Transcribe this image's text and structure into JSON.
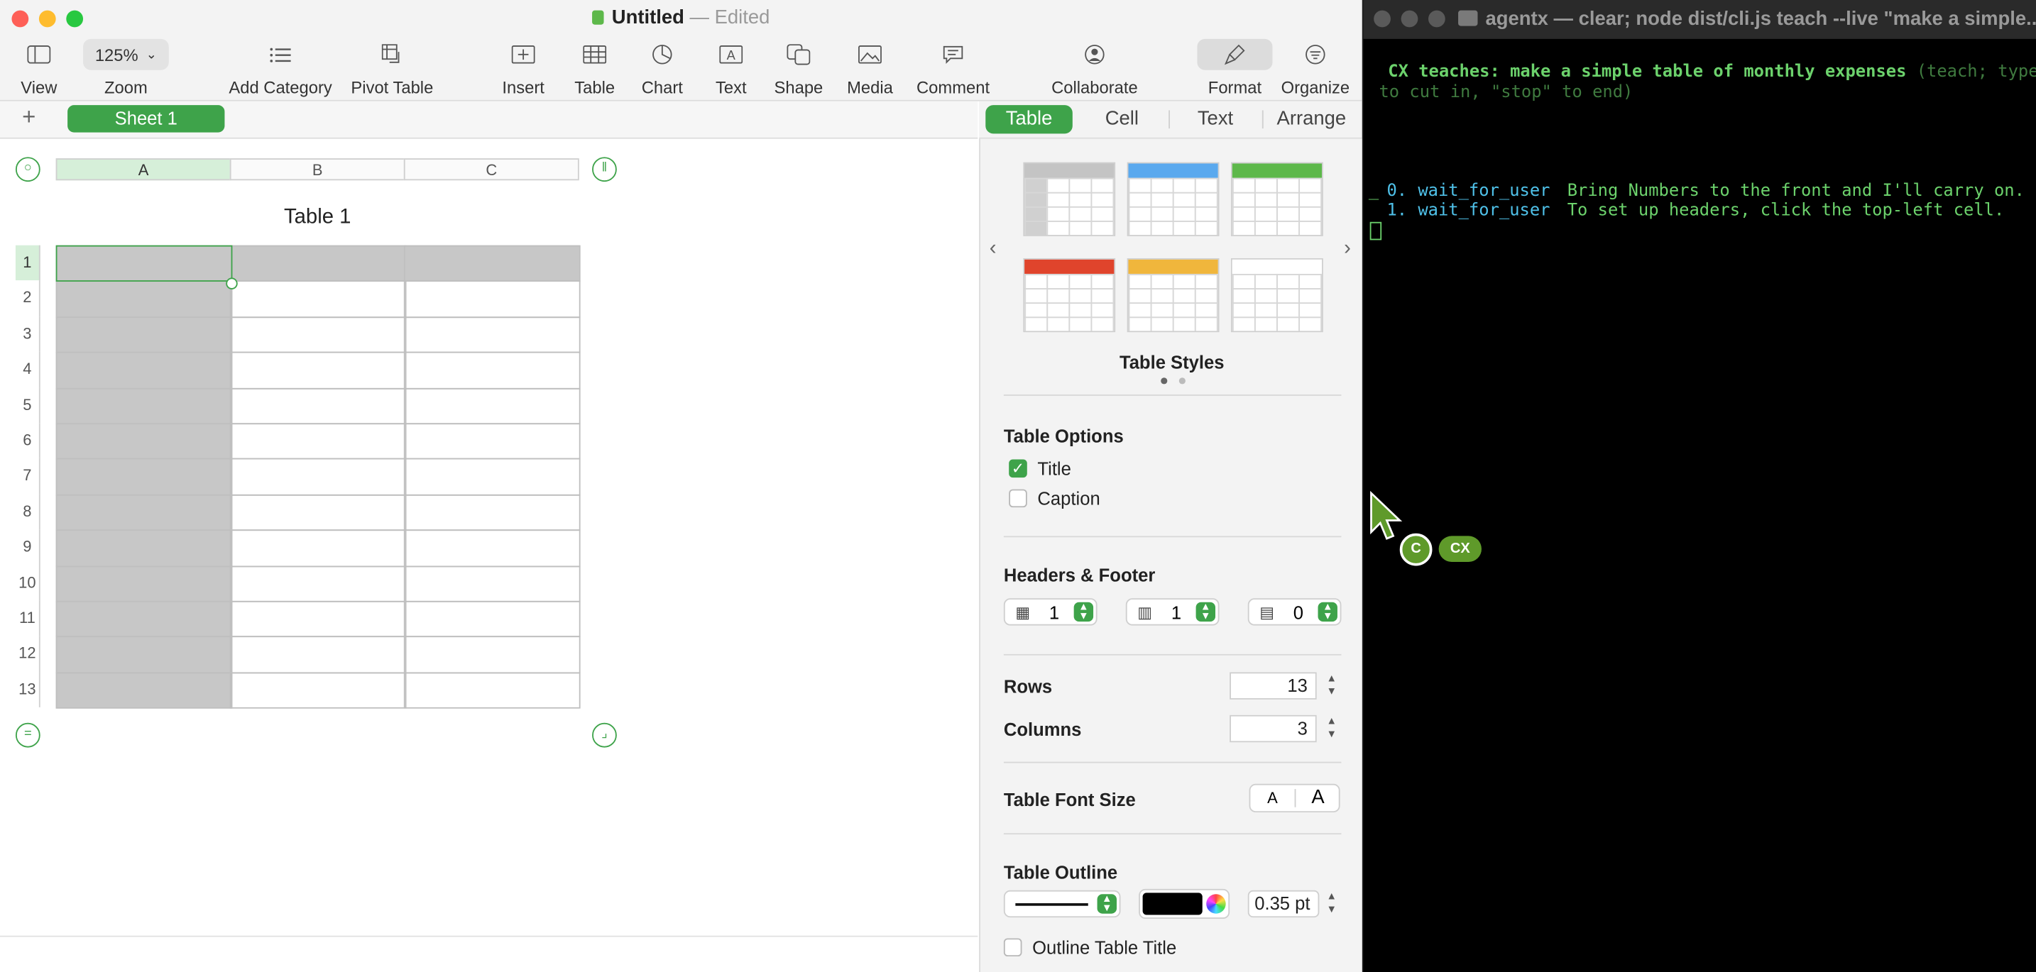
{
  "window": {
    "doc_title": "Untitled",
    "separator": "—",
    "status": "Edited"
  },
  "toolbar": {
    "view_label": "View",
    "zoom_value": "125%",
    "zoom_label": "Zoom",
    "add_category_label": "Add Category",
    "pivot_table_label": "Pivot Table",
    "insert_label": "Insert",
    "table_label": "Table",
    "chart_label": "Chart",
    "text_label": "Text",
    "shape_label": "Shape",
    "media_label": "Media",
    "comment_label": "Comment",
    "collaborate_label": "Collaborate",
    "format_label": "Format",
    "organize_label": "Organize"
  },
  "sheets": {
    "add_symbol": "+",
    "tabs": [
      {
        "label": "Sheet 1",
        "active": true
      }
    ]
  },
  "inspector": {
    "tabs": [
      {
        "label": "Table",
        "active": true
      },
      {
        "label": "Cell"
      },
      {
        "label": "Text"
      },
      {
        "label": "Arrange"
      }
    ],
    "table_styles_label": "Table Styles",
    "style_colors": [
      "#c4c4c4",
      "#5aa9ee",
      "#5db84a",
      "#e0442c",
      "#f0b63c",
      "#ffffff"
    ],
    "table_options_label": "Table Options",
    "title_checkbox": {
      "label": "Title",
      "checked": true
    },
    "caption_checkbox": {
      "label": "Caption",
      "checked": false
    },
    "headers_footer_label": "Headers & Footer",
    "header_rows": "1",
    "header_columns": "1",
    "footer_rows": "0",
    "rows_label": "Rows",
    "rows_value": "13",
    "columns_label": "Columns",
    "columns_value": "3",
    "font_size_label": "Table Font Size",
    "font_small": "A",
    "font_large": "A",
    "outline_label": "Table Outline",
    "outline_color": "#000000",
    "outline_width": "0.35 pt",
    "outline_title_label": "Outline Table Title"
  },
  "table": {
    "title": "Table 1",
    "columns": [
      "A",
      "B",
      "C"
    ],
    "rows": [
      "1",
      "2",
      "3",
      "4",
      "5",
      "6",
      "7",
      "8",
      "9",
      "10",
      "11",
      "12",
      "13"
    ]
  },
  "terminal": {
    "title": "agentx — clear; node dist/cli.js teach --live \"make a simple...",
    "heading": "CX teaches: make a simple table of monthly expenses",
    "heading_hint": "(teach; type",
    "hint_line2": "to cut in, \"stop\" to end)",
    "steps": [
      {
        "num": "0.",
        "action": "wait_for_user",
        "text": "Bring Numbers to the front and I'll carry on."
      },
      {
        "num": "1.",
        "action": "wait_for_user",
        "text": "To set up headers, click the top-left cell."
      }
    ],
    "cursor_badge_letter": "C",
    "cursor_badge_label": "CX"
  },
  "colors": {
    "accent_green": "#3ea34a",
    "terminal_green": "#6cd26c",
    "terminal_cyan": "#4fc1e9",
    "header_gray": "#c7c7c7"
  }
}
